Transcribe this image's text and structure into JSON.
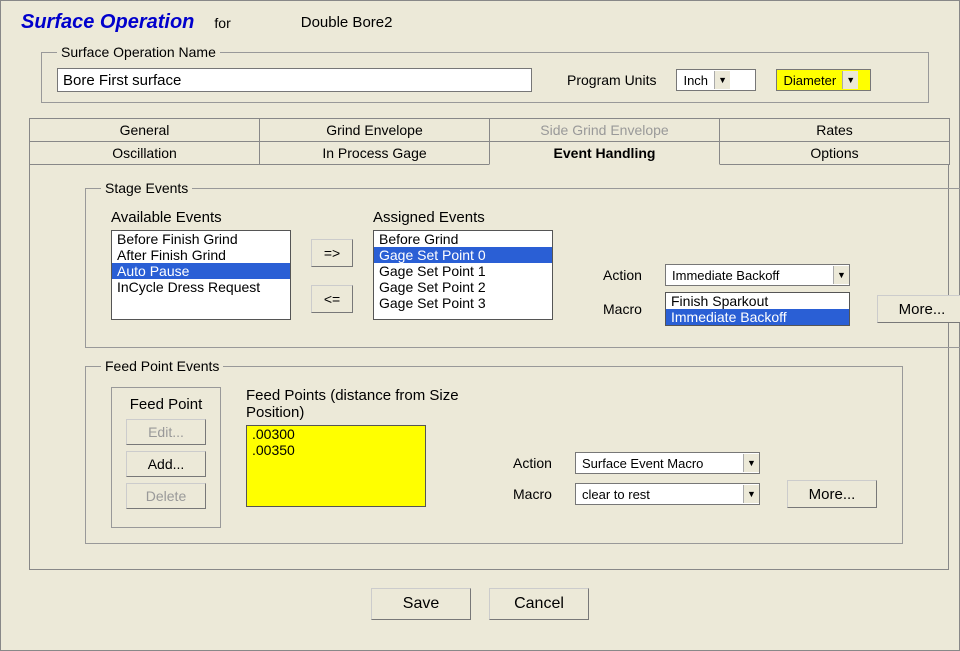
{
  "header": {
    "title": "Surface Operation",
    "for": "for",
    "surface_name": "Double Bore2"
  },
  "name_section": {
    "legend": "Surface Operation Name",
    "value": "Bore First surface",
    "program_units_label": "Program Units",
    "units_value": "Inch",
    "dim_value": "Diameter"
  },
  "tabs": {
    "row1": [
      "General",
      "Grind Envelope",
      "Side Grind Envelope",
      "Rates"
    ],
    "row2": [
      "Oscillation",
      "In Process Gage",
      "Event Handling",
      "Options"
    ]
  },
  "stage_events": {
    "legend": "Stage Events",
    "available_label": "Available Events",
    "available": [
      "Before Finish Grind",
      "After Finish Grind",
      "Auto Pause",
      "InCycle Dress Request"
    ],
    "available_selected": 2,
    "move_right": "=>",
    "move_left": "<=",
    "assigned_label": "Assigned Events",
    "assigned": [
      "Before Grind",
      "Gage Set Point 0",
      "Gage Set Point 1",
      "Gage Set Point 2",
      "Gage Set Point 3"
    ],
    "assigned_selected": 1,
    "action_label": "Action",
    "action_value": "Immediate Backoff",
    "macro_label": "Macro",
    "macro_options": [
      "Finish Sparkout",
      "Immediate Backoff"
    ],
    "macro_selected": 1,
    "more": "More..."
  },
  "feed_events": {
    "legend": "Feed Point Events",
    "fp_title": "Feed Point",
    "edit": "Edit...",
    "add": "Add...",
    "delete": "Delete",
    "list_label": "Feed Points (distance from Size Position)",
    "points": [
      ".00300",
      ".00350"
    ],
    "action_label": "Action",
    "action_value": "Surface Event Macro",
    "macro_label": "Macro",
    "macro_value": "clear to rest",
    "more": "More..."
  },
  "buttons": {
    "save": "Save",
    "cancel": "Cancel"
  }
}
